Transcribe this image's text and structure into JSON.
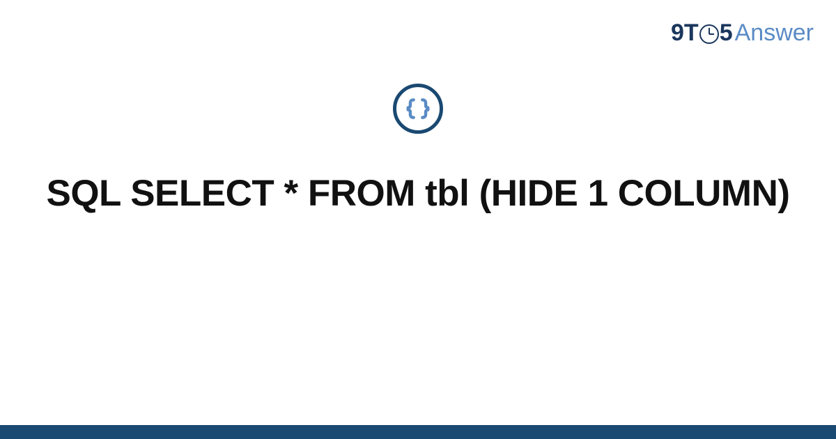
{
  "brand": {
    "nine": "9",
    "t": "T",
    "five": "5",
    "answer": "Answer"
  },
  "icon_name": "braces-icon",
  "title": "SQL SELECT * FROM tbl (HIDE 1 COLUMN)",
  "colors": {
    "brand_dark": "#1a365d",
    "brand_light": "#5a8bc4",
    "icon_ring": "#1a4971",
    "footer": "#1a4971"
  }
}
